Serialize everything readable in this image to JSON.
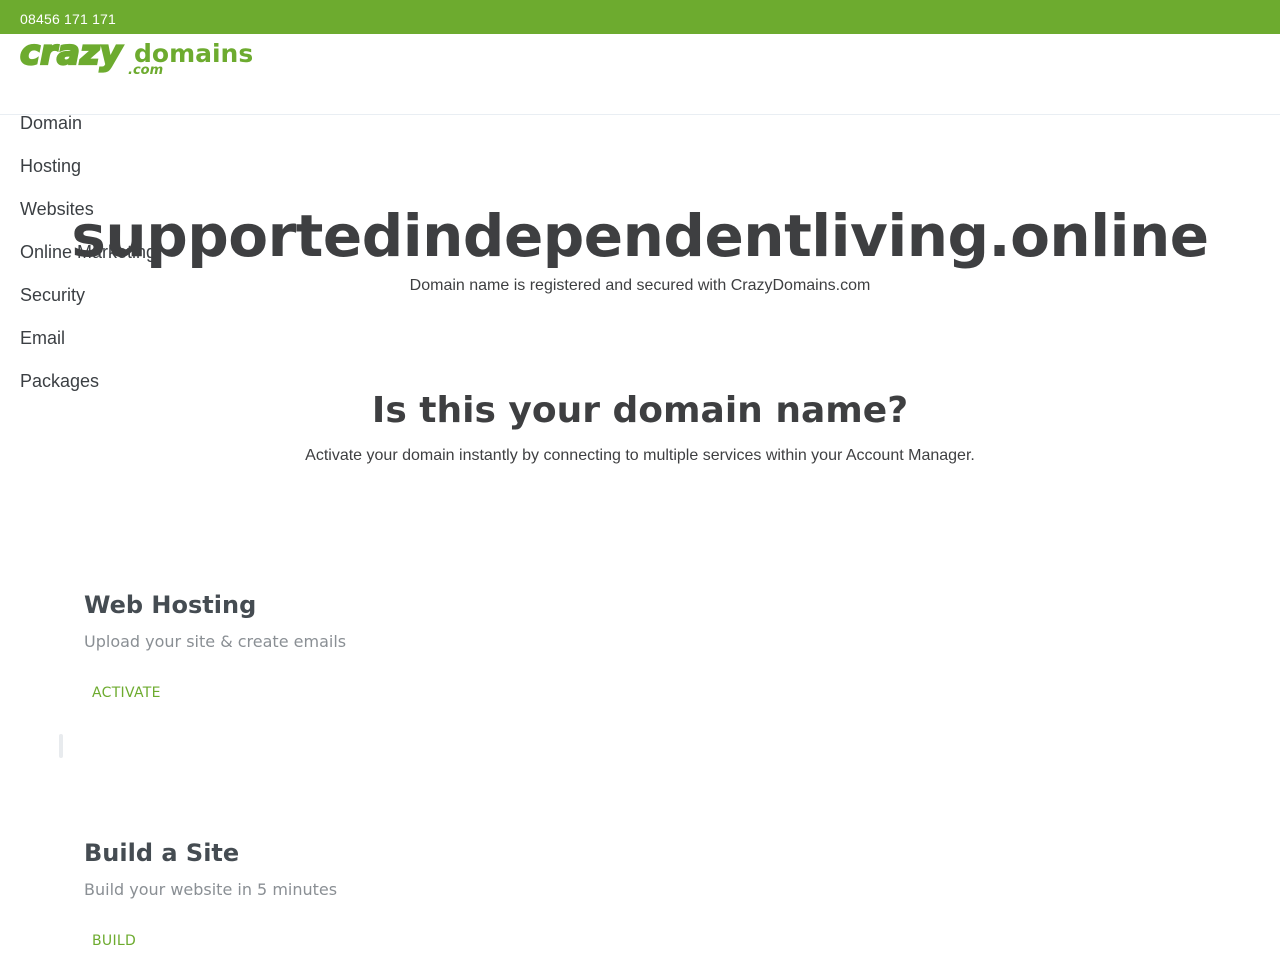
{
  "topbar": {
    "phone": "08456 171 171"
  },
  "brand": {
    "logo_text_crazy": "crazy",
    "logo_text_domains": "domains",
    "logo_text_tld": ".com",
    "color": "#6dab2f"
  },
  "nav": {
    "items": [
      {
        "label": "Domain"
      },
      {
        "label": "Hosting"
      },
      {
        "label": "Websites"
      },
      {
        "label": "Online Marketing"
      },
      {
        "label": "Security"
      },
      {
        "label": "Email"
      },
      {
        "label": "Packages"
      }
    ]
  },
  "hero": {
    "domain": "supportedindependentliving.online",
    "subtitle": "Domain name is registered and secured with CrazyDomains.com"
  },
  "question": {
    "title": "Is this your domain name?",
    "subtitle": "Activate your domain instantly by connecting to multiple services within your Account Manager."
  },
  "cards": [
    {
      "title": "Web Hosting",
      "description": "Upload your site & create emails",
      "action": "ACTIVATE"
    },
    {
      "title": "Build a Site",
      "description": "Build your website in 5 minutes",
      "action": "BUILD"
    }
  ]
}
